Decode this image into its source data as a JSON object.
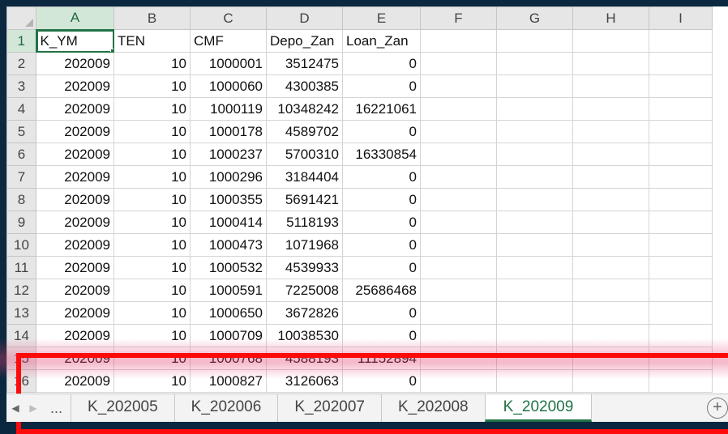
{
  "columns": [
    "A",
    "B",
    "C",
    "D",
    "E",
    "F",
    "G",
    "H",
    "I"
  ],
  "rows": [
    {
      "n": "1",
      "cells": [
        "K_YM",
        "TEN",
        "CMF",
        "Depo_Zan",
        "Loan_Zan",
        "",
        "",
        "",
        ""
      ]
    },
    {
      "n": "2",
      "cells": [
        "202009",
        "10",
        "1000001",
        "3512475",
        "0",
        "",
        "",
        "",
        ""
      ]
    },
    {
      "n": "3",
      "cells": [
        "202009",
        "10",
        "1000060",
        "4300385",
        "0",
        "",
        "",
        "",
        ""
      ]
    },
    {
      "n": "4",
      "cells": [
        "202009",
        "10",
        "1000119",
        "10348242",
        "16221061",
        "",
        "",
        "",
        ""
      ]
    },
    {
      "n": "5",
      "cells": [
        "202009",
        "10",
        "1000178",
        "4589702",
        "0",
        "",
        "",
        "",
        ""
      ]
    },
    {
      "n": "6",
      "cells": [
        "202009",
        "10",
        "1000237",
        "5700310",
        "16330854",
        "",
        "",
        "",
        ""
      ]
    },
    {
      "n": "7",
      "cells": [
        "202009",
        "10",
        "1000296",
        "3184404",
        "0",
        "",
        "",
        "",
        ""
      ]
    },
    {
      "n": "8",
      "cells": [
        "202009",
        "10",
        "1000355",
        "5691421",
        "0",
        "",
        "",
        "",
        ""
      ]
    },
    {
      "n": "9",
      "cells": [
        "202009",
        "10",
        "1000414",
        "5118193",
        "0",
        "",
        "",
        "",
        ""
      ]
    },
    {
      "n": "10",
      "cells": [
        "202009",
        "10",
        "1000473",
        "1071968",
        "0",
        "",
        "",
        "",
        ""
      ]
    },
    {
      "n": "11",
      "cells": [
        "202009",
        "10",
        "1000532",
        "4539933",
        "0",
        "",
        "",
        "",
        ""
      ]
    },
    {
      "n": "12",
      "cells": [
        "202009",
        "10",
        "1000591",
        "7225008",
        "25686468",
        "",
        "",
        "",
        ""
      ]
    },
    {
      "n": "13",
      "cells": [
        "202009",
        "10",
        "1000650",
        "3672826",
        "0",
        "",
        "",
        "",
        ""
      ]
    },
    {
      "n": "14",
      "cells": [
        "202009",
        "10",
        "1000709",
        "10038530",
        "0",
        "",
        "",
        "",
        ""
      ]
    },
    {
      "n": "15",
      "cells": [
        "202009",
        "10",
        "1000768",
        "4588193",
        "11152894",
        "",
        "",
        "",
        ""
      ]
    },
    {
      "n": "16",
      "cells": [
        "202009",
        "10",
        "1000827",
        "3126063",
        "0",
        "",
        "",
        "",
        ""
      ]
    }
  ],
  "tabs": {
    "prev_icon": "triangle-left-icon",
    "next_icon": "triangle-right-icon",
    "more": "...",
    "items": [
      "K_202005",
      "K_202006",
      "K_202007",
      "K_202008",
      "K_202009"
    ],
    "active": "K_202009",
    "add_icon": "plus-circle-icon"
  },
  "colors": {
    "accent": "#217346",
    "annotation_box": "#ff0a0a",
    "highlight_band": "#e23c6e",
    "background": "#0b2840"
  }
}
